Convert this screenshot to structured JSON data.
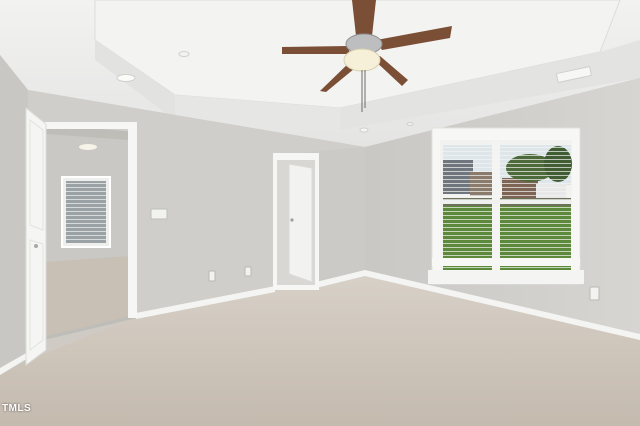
{
  "watermark": {
    "text": "TMLS"
  },
  "colors": {
    "wall_left": "#d3d2cf",
    "wall_back": "#cfcecb",
    "wall_right": "#d2d1ce",
    "ceiling": "#ebebea",
    "carpet": "#cbc3b9",
    "trim": "#f7f7f5",
    "fan_blade": "#7b4f36"
  },
  "icons": [
    "ceiling-fan-icon",
    "window-icon",
    "door-icon",
    "outlet-icon",
    "light-switch-icon"
  ]
}
